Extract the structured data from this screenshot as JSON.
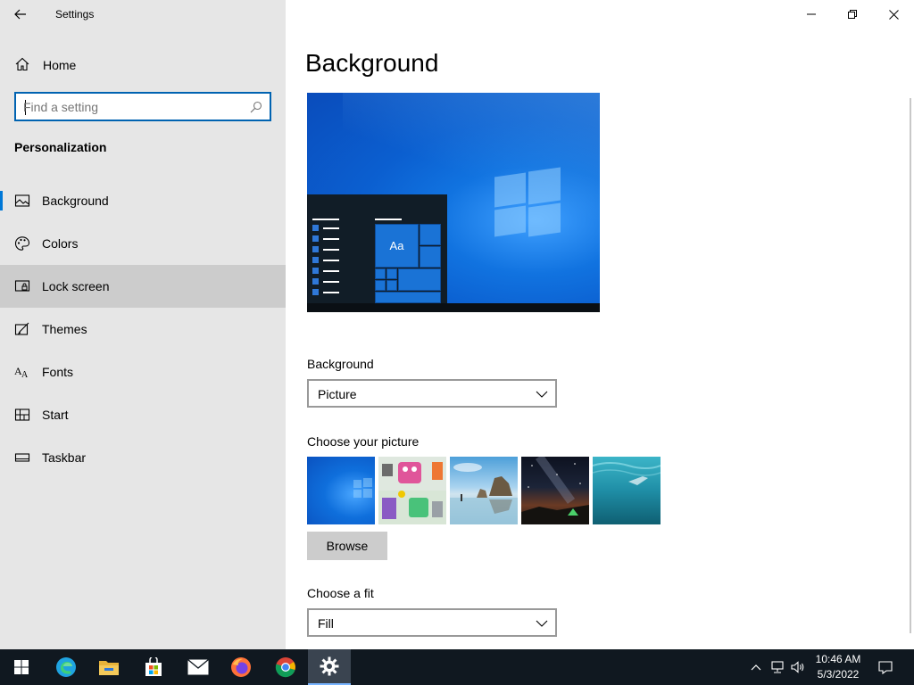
{
  "window": {
    "title": "Settings"
  },
  "sidebar": {
    "home_label": "Home",
    "search_placeholder": "Find a setting",
    "search_value": "",
    "section_title": "Personalization",
    "items": [
      {
        "label": "Background",
        "icon": "picture-icon",
        "selected": true
      },
      {
        "label": "Colors",
        "icon": "palette-icon",
        "selected": false
      },
      {
        "label": "Lock screen",
        "icon": "lock-screen-icon",
        "selected": false
      },
      {
        "label": "Themes",
        "icon": "brush-icon",
        "selected": false
      },
      {
        "label": "Fonts",
        "icon": "font-icon",
        "selected": false
      },
      {
        "label": "Start",
        "icon": "start-tiles-icon",
        "selected": false
      },
      {
        "label": "Taskbar",
        "icon": "taskbar-icon",
        "selected": false
      }
    ]
  },
  "main": {
    "page_title": "Background",
    "preview": {
      "tile_text": "Aa"
    },
    "background_label": "Background",
    "background_value": "Picture",
    "choose_picture_label": "Choose your picture",
    "thumbnails": [
      {
        "name": "windows-blue-wallpaper"
      },
      {
        "name": "cartoon-characters-wallpaper"
      },
      {
        "name": "beach-rocks-wallpaper"
      },
      {
        "name": "night-sky-tent-wallpaper"
      },
      {
        "name": "underwater-swimmer-wallpaper"
      }
    ],
    "browse_label": "Browse",
    "choose_fit_label": "Choose a fit",
    "fit_value": "Fill"
  },
  "taskbar": {
    "apps": [
      "start-icon",
      "edge-icon",
      "file-explorer-icon",
      "store-icon",
      "mail-icon",
      "firefox-icon",
      "chrome-icon",
      "settings-icon"
    ],
    "active_app": "settings-icon",
    "time": "10:46 AM",
    "date": "5/3/2022"
  },
  "colors": {
    "accent": "#0078d7",
    "sidebar_bg": "#e6e6e6",
    "hover_bg": "#cccccc",
    "taskbar_bg": "#101820"
  }
}
